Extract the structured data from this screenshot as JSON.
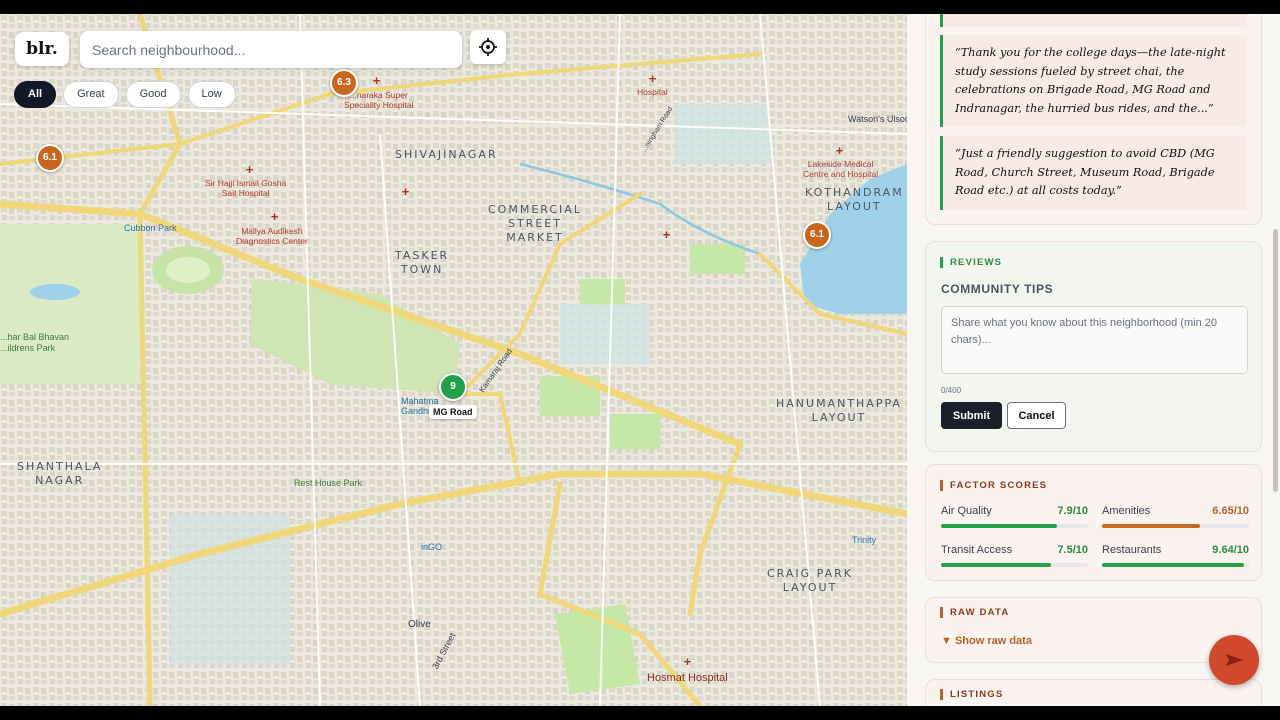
{
  "app": {
    "logo": "blr."
  },
  "search": {
    "placeholder": "Search neighbourhood..."
  },
  "filters": [
    {
      "label": "All",
      "active": true
    },
    {
      "label": "Great",
      "active": false
    },
    {
      "label": "Good",
      "active": false
    },
    {
      "label": "Low",
      "active": false
    }
  ],
  "map": {
    "areas": {
      "shivajinagar": "SHIVAJINAGAR",
      "commercial": "COMMERCIAL\nSTREET\nMARKET",
      "tasker": "TASKER\nTOWN",
      "kothandram": "KOTHANDRAM\nLAYOUT",
      "hanumanthappa": "HANUMANTHAPPA\nLAYOUT",
      "shanthala": "SHANTHALA\nNAGAR",
      "craig": "CRAIG PARK\nLAYOUT"
    },
    "pois": {
      "hospital_top": "Hospital",
      "narayana": "...narakа Super\nSpeciality Hospital",
      "haji": "Sir Hajji Ismail Gosha\nSait Hospital",
      "mallya": "Mallya Audikesh\nDiagnostics Center",
      "lakeside": "Lakeside Medical\nCentre and Hospital",
      "watsons": "Watson's Ulsoo",
      "cubbon": "Cubbon Park",
      "balbhavan": "...har Bal Bhavan\n...ildrens Park",
      "mahatma": "Mahatma\nGandhi",
      "resthouse": "Rest House Park",
      "ingo": "inGO",
      "olive": "Olive",
      "trinity": "Trinity",
      "hosmat": "Hosmat Hospital",
      "kamaraj": "Kamaraj Road",
      "third_street": "3rd Street",
      "cunningham": "...ningham Road"
    },
    "markers": [
      {
        "score": "6.3",
        "level": "good"
      },
      {
        "score": "6.1",
        "level": "good"
      },
      {
        "score": "6.1",
        "level": "good"
      },
      {
        "score": "9",
        "level": "great"
      }
    ],
    "selected_label": "MG Road"
  },
  "panel": {
    "quotes": [
      "“Thank you for the college days—the late-night study sessions fueled by street chai, the celebrations on Brigade Road, MG Road and Indranagar, the hurried bus rides, and the...”",
      "“Just a friendly suggestion to avoid CBD (MG Road, Church Street, Museum Road, Brigade Road etc.) at all costs today.”"
    ],
    "reviews": {
      "tag": "REVIEWS",
      "title": "COMMUNITY TIPS",
      "placeholder": "Share what you know about this neighborhood (min 20 chars)...",
      "counter": "0/400",
      "submit": "Submit",
      "cancel": "Cancel"
    },
    "factors": {
      "tag": "FACTOR SCORES",
      "items": [
        {
          "name": "Air Quality",
          "value": "7.9/10",
          "score": 7.9,
          "color": "#22a04a"
        },
        {
          "name": "Amenities",
          "value": "6.65/10",
          "score": 6.65,
          "color": "#c9661d"
        },
        {
          "name": "Transit Access",
          "value": "7.5/10",
          "score": 7.5,
          "color": "#22a04a"
        },
        {
          "name": "Restaurants",
          "value": "9.64/10",
          "score": 9.64,
          "color": "#22a04a"
        }
      ]
    },
    "raw": {
      "tag": "RAW DATA",
      "toggle": "▼ Show raw data"
    },
    "listings": {
      "tag": "LISTINGS"
    }
  },
  "colors": {
    "great": "#22a04a",
    "good": "#c9661d",
    "accent": "#b5632a",
    "water": "#9fd2ea"
  }
}
